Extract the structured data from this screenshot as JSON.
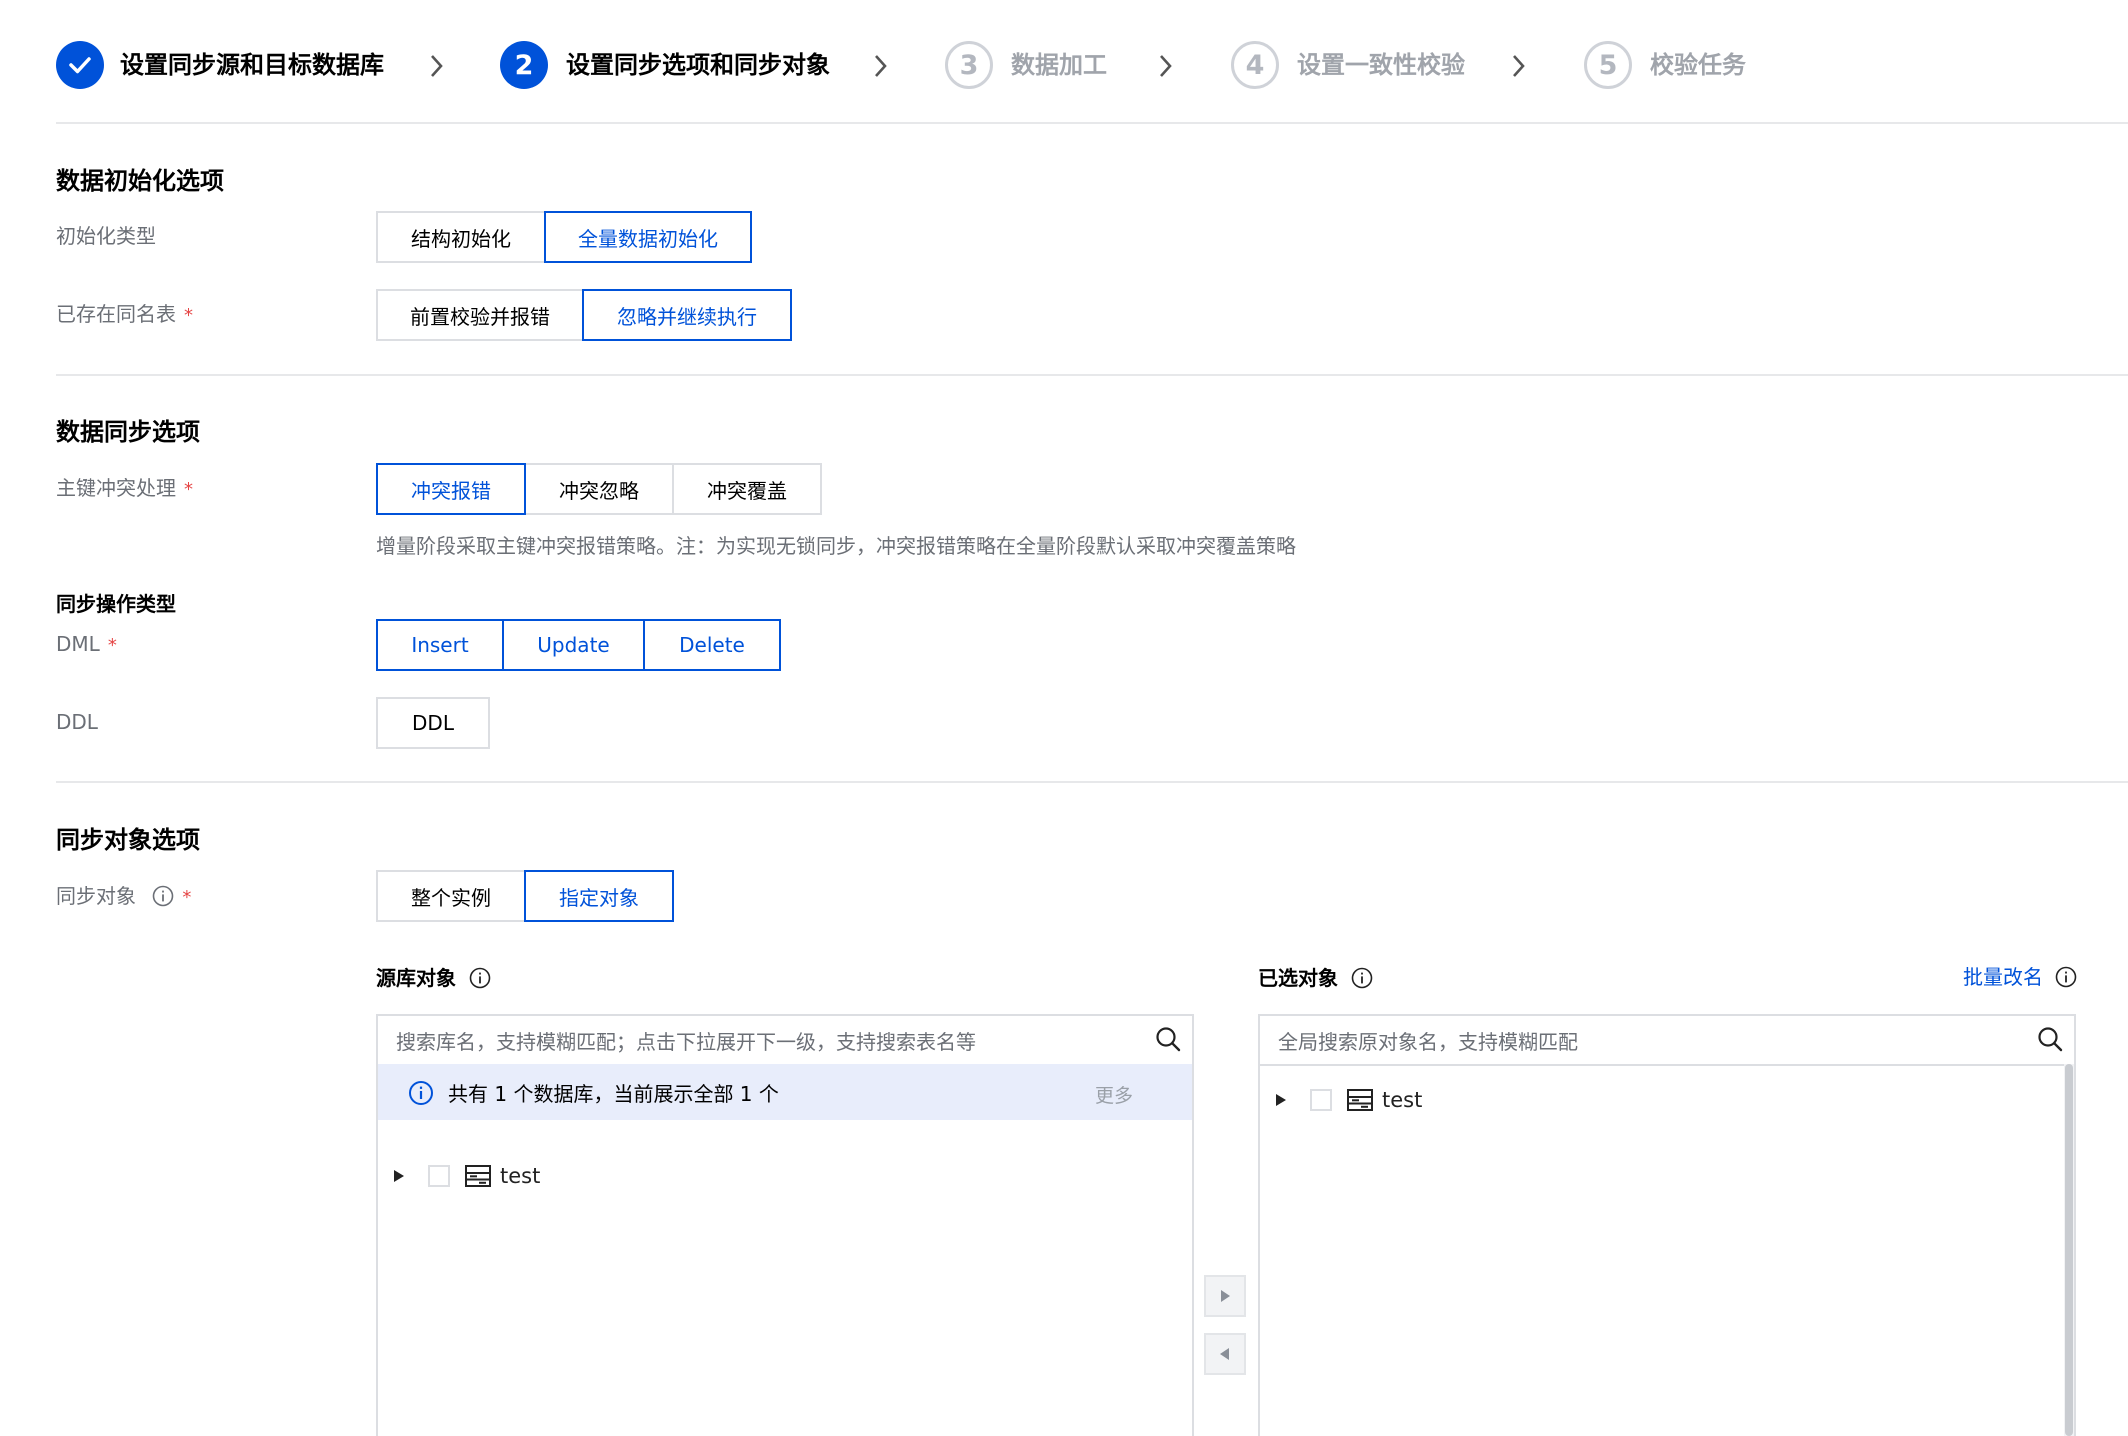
{
  "steps": [
    {
      "num": "",
      "label": "设置同步源和目标数据库",
      "state": "done"
    },
    {
      "num": "2",
      "label": "设置同步选项和同步对象",
      "state": "active"
    },
    {
      "num": "3",
      "label": "数据加工",
      "state": "todo"
    },
    {
      "num": "4",
      "label": "设置一致性校验",
      "state": "todo"
    },
    {
      "num": "5",
      "label": "校验任务",
      "state": "todo"
    }
  ],
  "init_section": {
    "title": "数据初始化选项",
    "init_type_label": "初始化类型",
    "init_type_options": [
      "结构初始化",
      "全量数据初始化"
    ],
    "existing_table_label": "已存在同名表",
    "existing_table_options": [
      "前置校验并报错",
      "忽略并继续执行"
    ]
  },
  "sync_section": {
    "title": "数据同步选项",
    "pk_conflict_label": "主键冲突处理",
    "pk_conflict_options": [
      "冲突报错",
      "冲突忽略",
      "冲突覆盖"
    ],
    "pk_conflict_hint": "增量阶段采取主键冲突报错策略。注：为实现无锁同步，冲突报错策略在全量阶段默认采取冲突覆盖策略",
    "op_type_label": "同步操作类型",
    "dml_label": "DML",
    "dml_options": [
      "Insert",
      "Update",
      "Delete"
    ],
    "ddl_label": "DDL",
    "ddl_options": [
      "DDL"
    ]
  },
  "object_section": {
    "title": "同步对象选项",
    "sync_object_label": "同步对象",
    "sync_object_options": [
      "整个实例",
      "指定对象"
    ],
    "source_title": "源库对象",
    "source_search_placeholder": "搜索库名，支持模糊匹配；点击下拉展开下一级，支持搜索表名等",
    "source_notice": "共有 1 个数据库，当前展示全部 1 个",
    "source_more": "更多",
    "source_tree": [
      "test"
    ],
    "selected_title": "已选对象",
    "batch_rename": "批量改名",
    "selected_search_placeholder": "全局搜索原对象名，支持模糊匹配",
    "selected_tree": [
      "test"
    ]
  },
  "required_mark": "*",
  "colors": {
    "accent": "#0052d9",
    "required": "#e54545",
    "notice_bg": "#e8edfb"
  }
}
